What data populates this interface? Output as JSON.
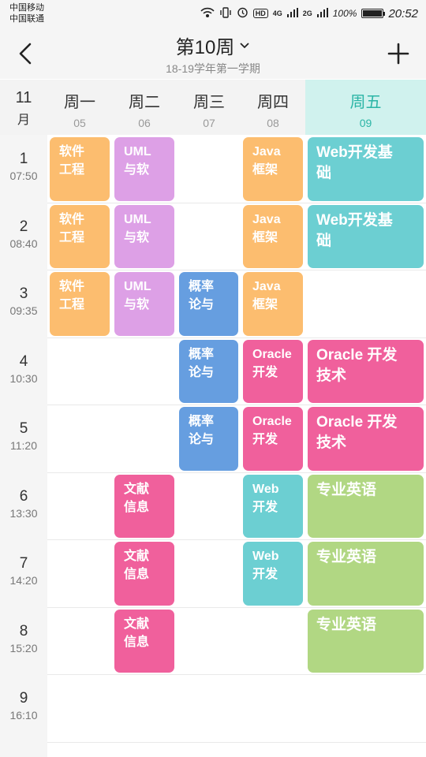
{
  "status_bar": {
    "carrier_1": "中国移动",
    "carrier_2": "中国联通",
    "network_1": "4G",
    "network_2": "2G",
    "battery": "100%",
    "battery_level": 1.0,
    "time": "20:52"
  },
  "header": {
    "title": "第10周",
    "subtitle": "18-19学年第一学期"
  },
  "day_header": {
    "month_number": "11",
    "month_unit": "月",
    "days": [
      {
        "name": "周一",
        "date": "05"
      },
      {
        "name": "周二",
        "date": "06"
      },
      {
        "name": "周三",
        "date": "07"
      },
      {
        "name": "周四",
        "date": "08"
      },
      {
        "name": "周五",
        "date": "09"
      }
    ]
  },
  "periods": [
    {
      "num": "1",
      "time": "07:50"
    },
    {
      "num": "2",
      "time": "08:40"
    },
    {
      "num": "3",
      "time": "09:35"
    },
    {
      "num": "4",
      "time": "10:30"
    },
    {
      "num": "5",
      "time": "11:20"
    },
    {
      "num": "6",
      "time": "13:30"
    },
    {
      "num": "7",
      "time": "14:20"
    },
    {
      "num": "8",
      "time": "15:20"
    },
    {
      "num": "9",
      "time": "16:10"
    }
  ],
  "courses": [
    {
      "day": 0,
      "period": 0,
      "line1": "软件",
      "line2": "工程",
      "color": "#fcbd6f"
    },
    {
      "day": 0,
      "period": 1,
      "line1": "软件",
      "line2": "工程",
      "color": "#fcbd6f"
    },
    {
      "day": 0,
      "period": 2,
      "line1": "软件",
      "line2": "工程",
      "color": "#fcbd6f"
    },
    {
      "day": 1,
      "period": 0,
      "line1": "UML",
      "line2": "与软",
      "color": "#dda0e6"
    },
    {
      "day": 1,
      "period": 1,
      "line1": "UML",
      "line2": "与软",
      "color": "#dda0e6"
    },
    {
      "day": 1,
      "period": 2,
      "line1": "UML",
      "line2": "与软",
      "color": "#dda0e6"
    },
    {
      "day": 1,
      "period": 5,
      "line1": "文献",
      "line2": "信息",
      "color": "#f0609c"
    },
    {
      "day": 1,
      "period": 6,
      "line1": "文献",
      "line2": "信息",
      "color": "#f0609c"
    },
    {
      "day": 1,
      "period": 7,
      "line1": "文献",
      "line2": "信息",
      "color": "#f0609c"
    },
    {
      "day": 2,
      "period": 2,
      "line1": "概率",
      "line2": "论与",
      "color": "#669ee0"
    },
    {
      "day": 2,
      "period": 3,
      "line1": "概率",
      "line2": "论与",
      "color": "#669ee0"
    },
    {
      "day": 2,
      "period": 4,
      "line1": "概率",
      "line2": "论与",
      "color": "#669ee0"
    },
    {
      "day": 3,
      "period": 0,
      "line1": "Java",
      "line2": "框架",
      "color": "#fcbd6f"
    },
    {
      "day": 3,
      "period": 1,
      "line1": "Java",
      "line2": "框架",
      "color": "#fcbd6f"
    },
    {
      "day": 3,
      "period": 2,
      "line1": "Java",
      "line2": "框架",
      "color": "#fcbd6f"
    },
    {
      "day": 3,
      "period": 3,
      "line1": "Oracle",
      "line2": "开发",
      "color": "#f0609c"
    },
    {
      "day": 3,
      "period": 4,
      "line1": "Oracle",
      "line2": "开发",
      "color": "#f0609c"
    },
    {
      "day": 3,
      "period": 5,
      "line1": "Web",
      "line2": "开发",
      "color": "#6ccfd2"
    },
    {
      "day": 3,
      "period": 6,
      "line1": "Web",
      "line2": "开发",
      "color": "#6ccfd2"
    },
    {
      "day": 4,
      "period": 0,
      "line1": "Web开发基",
      "line2": "础",
      "color": "#6ccfd2"
    },
    {
      "day": 4,
      "period": 1,
      "line1": "Web开发基",
      "line2": "础",
      "color": "#6ccfd2"
    },
    {
      "day": 4,
      "period": 3,
      "line1": "Oracle 开发",
      "line2": "技术",
      "color": "#f0609c"
    },
    {
      "day": 4,
      "period": 4,
      "line1": "Oracle 开发",
      "line2": "技术",
      "color": "#f0609c"
    },
    {
      "day": 4,
      "period": 5,
      "line1": "专业英语",
      "line2": "",
      "color": "#b1d783"
    },
    {
      "day": 4,
      "period": 6,
      "line1": "专业英语",
      "line2": "",
      "color": "#b1d783"
    },
    {
      "day": 4,
      "period": 7,
      "line1": "专业英语",
      "line2": "",
      "color": "#b1d783"
    }
  ]
}
